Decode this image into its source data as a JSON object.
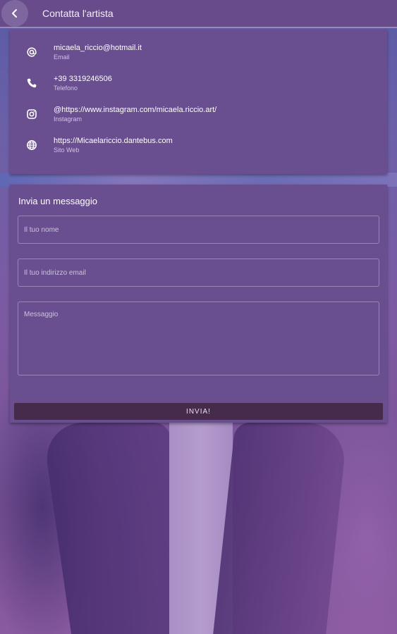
{
  "header": {
    "title": "Contatta l'artista",
    "back_icon": "chevron-left-icon"
  },
  "contacts": [
    {
      "icon": "at-sign-icon",
      "value": "micaela_riccio@hotmail.it",
      "label": "Email"
    },
    {
      "icon": "phone-icon",
      "value": "+39 3319246506",
      "label": "Telefono"
    },
    {
      "icon": "instagram-icon",
      "value": "@https://www.instagram.com/micaela.riccio.art/",
      "label": "Instagram"
    },
    {
      "icon": "globe-icon",
      "value": "https://Micaelariccio.dantebus.com",
      "label": "Sito Web"
    }
  ],
  "message_form": {
    "title": "Invia un messaggio",
    "name_placeholder": "Il tuo nome",
    "email_placeholder": "Il tuo indirizzo email",
    "message_placeholder": "Messaggio",
    "send_label": "INVIA!"
  },
  "colors": {
    "header_bg": "#674b8a",
    "card_bg": "#694f8f",
    "button_bg": "#472b4c"
  }
}
